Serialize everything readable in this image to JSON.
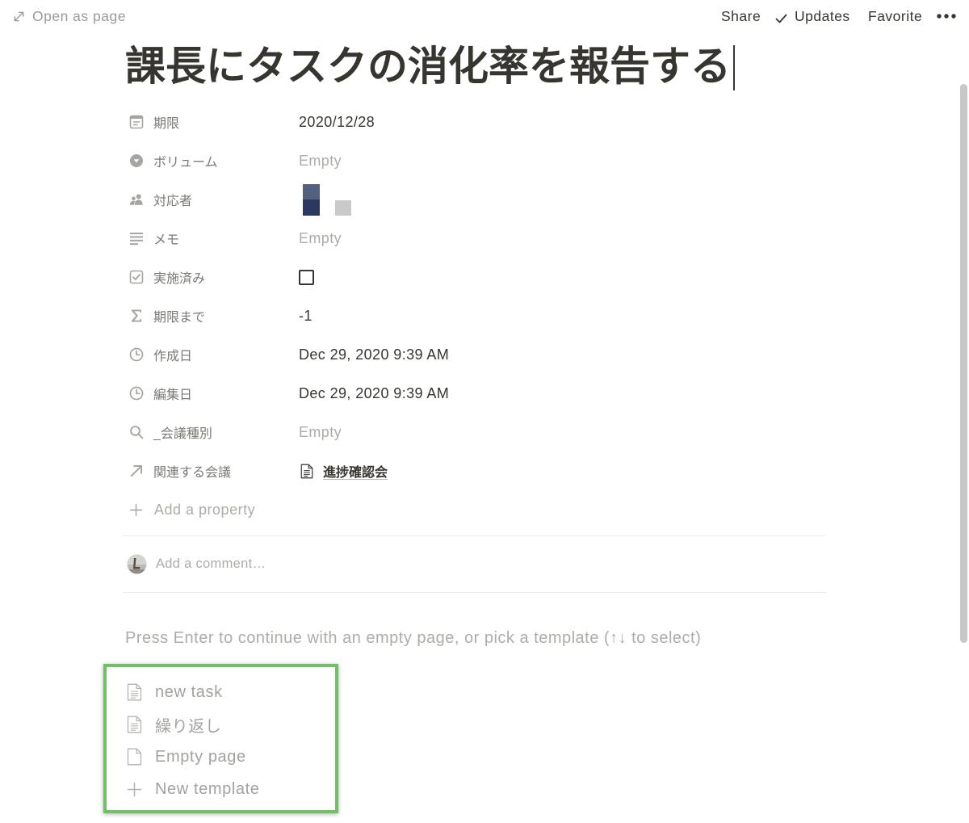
{
  "colors": {
    "text": "#37352f",
    "label": "#7a7975",
    "muted": "#adaca8",
    "icon": "#a6a5a1",
    "subtle": "#9b9a97",
    "divider": "#ebebea",
    "highlight": "#71c064",
    "scrollbar": "#c8c8c8"
  },
  "topbar": {
    "open_as_page": "Open as page",
    "open_as_page_icon": "expand-icon",
    "share": "Share",
    "updates": "Updates",
    "updates_icon": "check-icon",
    "favorite": "Favorite",
    "more_icon": "more-horizontal-icon"
  },
  "page": {
    "title": "課長にタスクの消化率を報告する"
  },
  "properties": [
    {
      "icon": "calendar-icon",
      "label": "期限",
      "value": "2020/12/28"
    },
    {
      "icon": "select-icon",
      "label": "ボリューム",
      "value": "Empty"
    },
    {
      "icon": "people-icon",
      "label": "対応者",
      "value_icon": "person-avatar-icon"
    },
    {
      "icon": "text-icon",
      "label": "メモ",
      "value": "Empty"
    },
    {
      "icon": "checkbox-icon",
      "label": "実施済み",
      "checked": false
    },
    {
      "icon": "sigma-icon",
      "label": "期限まで",
      "value": "-1"
    },
    {
      "icon": "clock-icon",
      "label": "作成日",
      "value": "Dec 29, 2020 9:39 AM"
    },
    {
      "icon": "clock-icon",
      "label": "編集日",
      "value": "Dec 29, 2020 9:39 AM"
    },
    {
      "icon": "search-icon",
      "label": "_会議種別",
      "value": "Empty"
    },
    {
      "icon": "relation-arrow-icon",
      "label": "関連する会議",
      "value": "進捗確認会",
      "value_icon": "page-icon"
    }
  ],
  "add_property": "Add a property",
  "comments": {
    "placeholder": "Add a comment…"
  },
  "template_picker": {
    "hint": "Press Enter to continue with an empty page, or pick a template (↑↓ to select)",
    "items": [
      {
        "label": "new task",
        "icon": "page-text-icon"
      },
      {
        "label": "繰り返し",
        "icon": "page-text-icon"
      },
      {
        "label": "Empty page",
        "icon": "page-empty-icon"
      },
      {
        "label": "New template",
        "icon": "plus-icon"
      }
    ]
  }
}
